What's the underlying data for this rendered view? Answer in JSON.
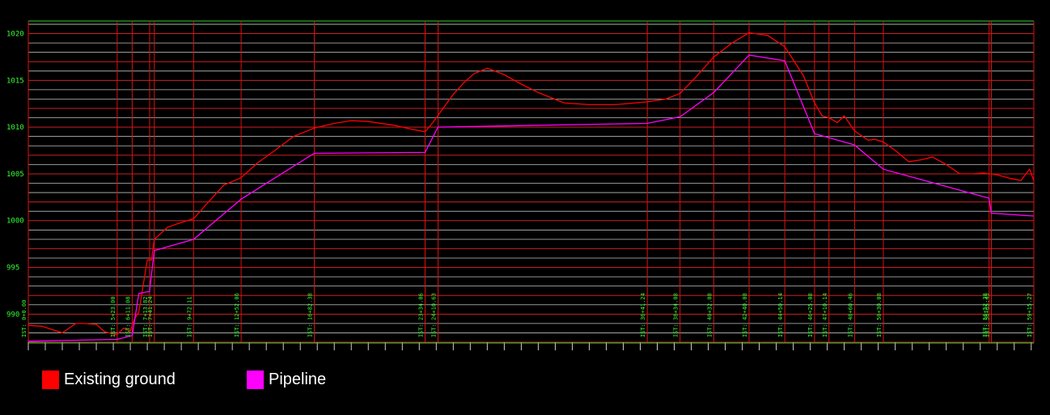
{
  "chart_data": {
    "type": "line",
    "title": "",
    "xlabel": "",
    "ylabel": "",
    "xlim": [
      0,
      5915.27
    ],
    "ylim": [
      987,
      1021
    ],
    "grid": true,
    "y_ticks": [
      990,
      995,
      1000,
      1005,
      1010,
      1015,
      1020
    ],
    "y_tick_labels": [
      "990",
      "995",
      "1000",
      "1005",
      "1010",
      "1015",
      "1020"
    ],
    "stations": [
      {
        "x": 0,
        "label": "IST: 0+0.00"
      },
      {
        "x": 523,
        "label": "IST: 5+23.00"
      },
      {
        "x": 611.08,
        "label": "IST: 6+11.08"
      },
      {
        "x": 713.82,
        "label": "IST: 7+13.82"
      },
      {
        "x": 741.24,
        "label": "IST: 7+41.24"
      },
      {
        "x": 972.11,
        "label": "IST: 9+72.11"
      },
      {
        "x": 1252.06,
        "label": "IST: 12+52.06"
      },
      {
        "x": 1682.38,
        "label": "IST: 16+82.38"
      },
      {
        "x": 2334.06,
        "label": "IST: 23+34.06"
      },
      {
        "x": 2410.63,
        "label": "IST: 24+10.63"
      },
      {
        "x": 3641.24,
        "label": "IST: 36+41.24"
      },
      {
        "x": 3834.08,
        "label": "IST: 38+34.08"
      },
      {
        "x": 4032.08,
        "label": "IST: 40+32.08"
      },
      {
        "x": 4240.08,
        "label": "IST: 42+40.08"
      },
      {
        "x": 4450.14,
        "label": "IST: 44+50.14"
      },
      {
        "x": 4625.08,
        "label": "IST: 46+25.08"
      },
      {
        "x": 4710.14,
        "label": "IST: 47+10.14"
      },
      {
        "x": 4860.46,
        "label": "IST: 48+60.46"
      },
      {
        "x": 5030.08,
        "label": "IST: 50+30.08"
      },
      {
        "x": 5652.38,
        "label": "IST: 56+52.38"
      },
      {
        "x": 5665.45,
        "label": "IST: 56+65.45"
      },
      {
        "x": 5915.27,
        "label": "IST: 59+15.27"
      }
    ],
    "series": [
      {
        "name": "Existing ground",
        "color": "#ff0000",
        "x": [
          0,
          80,
          200,
          280,
          330,
          400,
          450,
          520,
          560,
          600,
          625,
          650,
          700,
          713,
          725,
          741,
          820,
          900,
          972,
          1050,
          1150,
          1252,
          1350,
          1450,
          1560,
          1682,
          1800,
          1900,
          2000,
          2150,
          2250,
          2334,
          2380,
          2440,
          2500,
          2560,
          2620,
          2700,
          2800,
          2900,
          3000,
          3150,
          3300,
          3450,
          3641,
          3750,
          3834,
          3930,
          4032,
          4140,
          4240,
          4350,
          4450,
          4560,
          4625,
          4670,
          4710,
          4760,
          4800,
          4860,
          4900,
          4940,
          4980,
          5030,
          5100,
          5180,
          5250,
          5320,
          5400,
          5480,
          5560,
          5620,
          5652,
          5700,
          5780,
          5840,
          5890,
          5915
        ],
        "values": [
          988.8,
          988.7,
          988.0,
          989.0,
          989.0,
          988.9,
          988.1,
          987.8,
          988.5,
          988.2,
          989.5,
          990.2,
          995.8,
          995.8,
          995.8,
          998.0,
          999.3,
          999.8,
          1000.2,
          1001.8,
          1003.8,
          1004.6,
          1006.2,
          1007.5,
          1009.0,
          1009.9,
          1010.4,
          1010.7,
          1010.6,
          1010.2,
          1009.8,
          1009.5,
          1010.5,
          1012.0,
          1013.5,
          1014.7,
          1015.7,
          1016.3,
          1015.6,
          1014.6,
          1013.7,
          1012.6,
          1012.4,
          1012.4,
          1012.7,
          1013.0,
          1013.6,
          1015.4,
          1017.5,
          1019.0,
          1020.1,
          1019.8,
          1018.6,
          1015.5,
          1012.6,
          1011.2,
          1011.0,
          1010.5,
          1011.2,
          1009.6,
          1009.1,
          1008.6,
          1008.7,
          1008.4,
          1007.5,
          1006.3,
          1006.5,
          1006.8,
          1006.0,
          1005.0,
          1005.0,
          1005.1,
          1005.0,
          1004.9,
          1004.5,
          1004.3,
          1005.5,
          1004.3
        ]
      },
      {
        "name": "Pipeline",
        "color": "#ff00ff",
        "x": [
          0,
          523,
          611,
          650,
          700,
          713,
          741,
          972,
          1252,
          1682,
          2334,
          2410,
          3641,
          3834,
          4032,
          4240,
          4450,
          4625,
          4860,
          5030,
          5652,
          5665,
          5915
        ],
        "values": [
          987.1,
          987.3,
          987.7,
          992.2,
          992.4,
          992.4,
          996.8,
          998.0,
          1002.3,
          1007.2,
          1007.3,
          1010.0,
          1010.4,
          1011.1,
          1013.7,
          1017.7,
          1017.1,
          1009.3,
          1008.1,
          1005.5,
          1002.4,
          1000.8,
          1000.5
        ]
      }
    ],
    "legend": {
      "position": "bottom-left",
      "items": [
        {
          "label": "Existing ground",
          "color": "#ff0000"
        },
        {
          "label": "Pipeline",
          "color": "#ff00ff"
        }
      ]
    }
  }
}
